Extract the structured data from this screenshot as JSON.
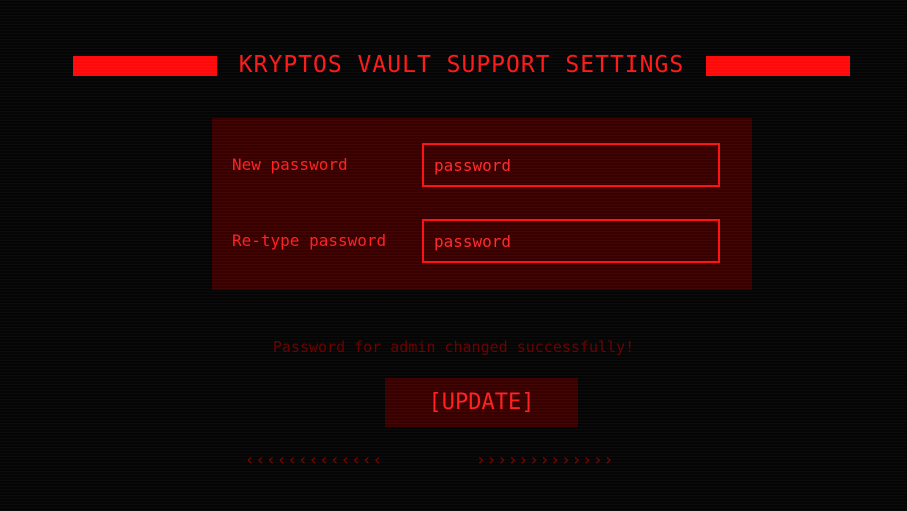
{
  "header": {
    "title": "KRYPTOS VAULT SUPPORT SETTINGS"
  },
  "form": {
    "new_password": {
      "label": "New password",
      "placeholder": "password"
    },
    "retype_password": {
      "label": "Re-type password",
      "placeholder": "password"
    }
  },
  "status": {
    "message": "Password for admin changed successfully!"
  },
  "actions": {
    "update_label": "[UPDATE]"
  },
  "decorations": {
    "left_chevrons": "‹‹‹‹‹‹‹‹‹‹‹‹‹",
    "right_chevrons": "›››››››››››››"
  },
  "colors": {
    "accent": "#ff1a1a",
    "panel": "#3a0000",
    "background": "#050505",
    "status_text": "#6a0000"
  }
}
